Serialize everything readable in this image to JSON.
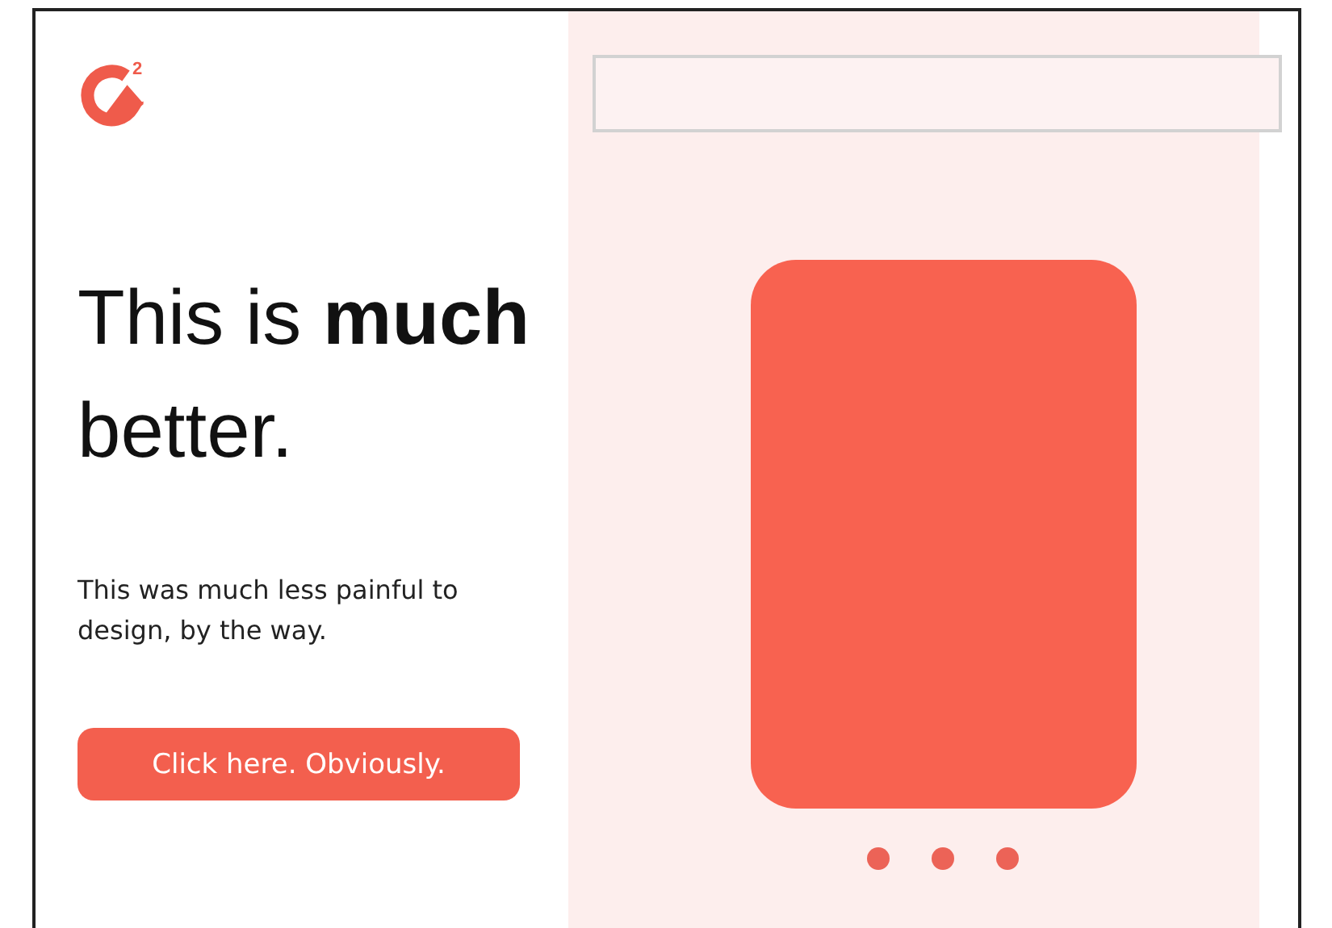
{
  "logo": {
    "mark": "2"
  },
  "hero": {
    "heading": "This is **much** better.",
    "body": "This was much less painful to design, by the way.",
    "button": "Click here. Obviously."
  },
  "carousel": {
    "dots": [
      {
        "kind": "dot"
      },
      {
        "kind": "dot"
      },
      {
        "kind": "dot"
      }
    ]
  }
}
